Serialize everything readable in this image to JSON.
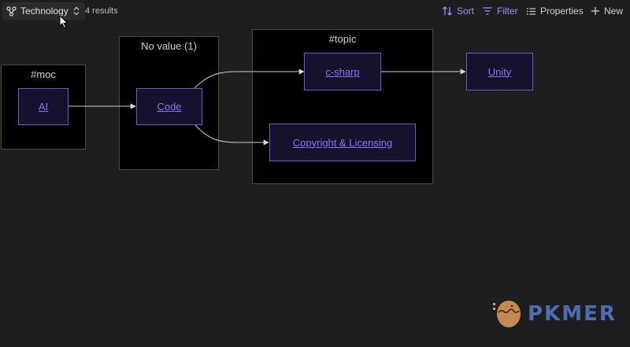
{
  "toolbar": {
    "view_name": "Technology",
    "results": "4 results",
    "sort_label": "Sort",
    "filter_label": "Filter",
    "properties_label": "Properties",
    "new_label": "New"
  },
  "groups": {
    "moc": "#moc",
    "no_value": "No value (1)",
    "topic": "#topic"
  },
  "nodes": {
    "ai": "AI",
    "code": "Code",
    "csharp": "c-sharp",
    "unity": "Unity",
    "copyright": "Copyright & Licensing"
  },
  "watermark": {
    "text": "PKMER"
  },
  "colors": {
    "accent": "#a88bfa",
    "node_border": "#6d58c9",
    "node_text": "#8f74f0",
    "group_border": "#4d4d1f",
    "background": "#1e1e1e"
  }
}
